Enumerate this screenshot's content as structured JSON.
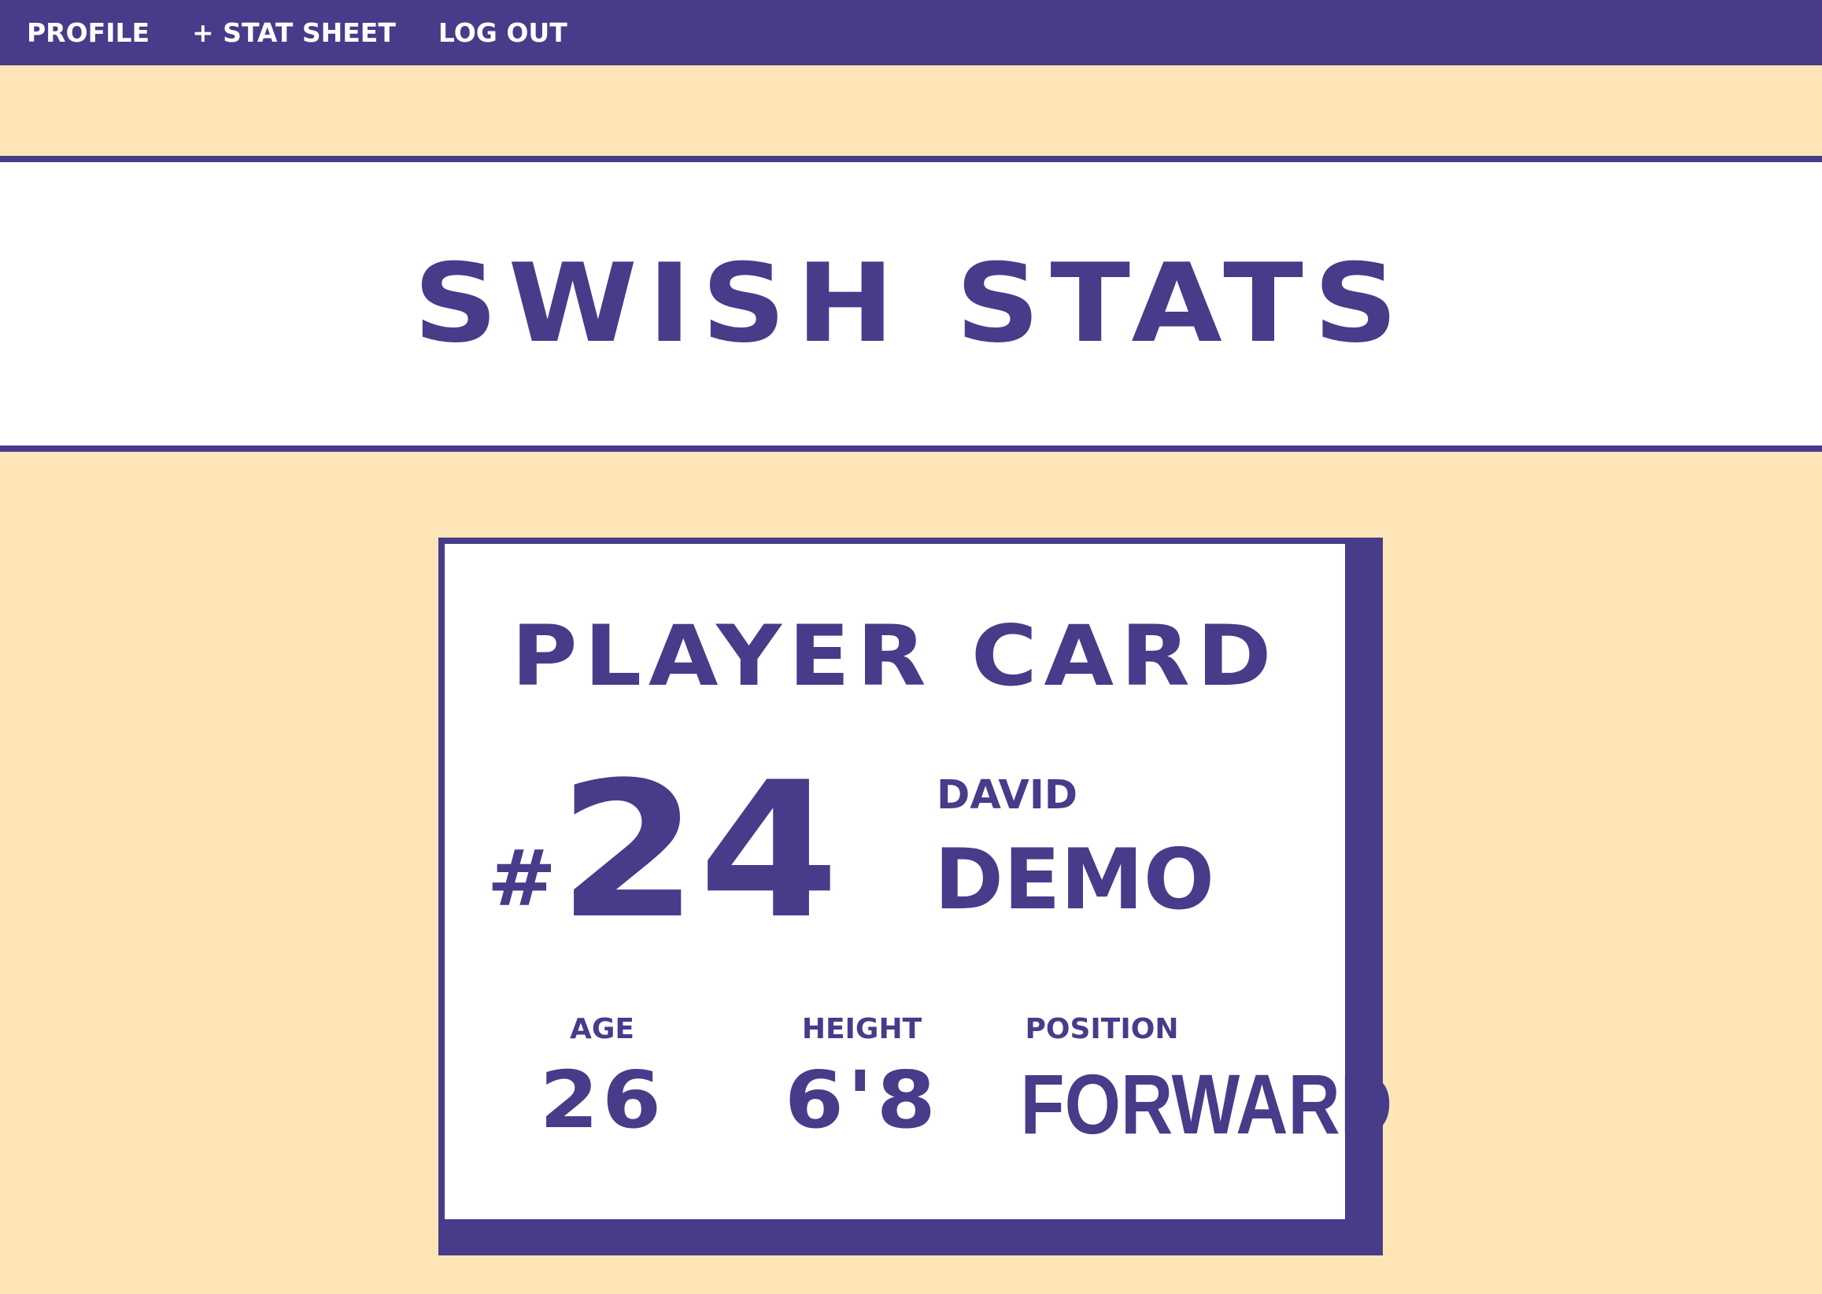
{
  "nav": {
    "links": [
      {
        "label": "PROFILE"
      },
      {
        "label": "+ STAT SHEET"
      },
      {
        "label": "LOG OUT"
      }
    ]
  },
  "site": {
    "title": "SWISH STATS"
  },
  "card": {
    "title": "PLAYER CARD",
    "hash": "#",
    "jersey_number": "24",
    "first_name": "DAVID",
    "last_name": "DEMO",
    "stats": [
      {
        "label": "AGE",
        "value": "26"
      },
      {
        "label": "HEIGHT",
        "value": "6'8"
      },
      {
        "label": "POSITION",
        "value": "FORWARD"
      }
    ]
  },
  "colors": {
    "accent": "#473C8A",
    "background": "#FEE5B8",
    "panel": "#FFFFFF"
  }
}
